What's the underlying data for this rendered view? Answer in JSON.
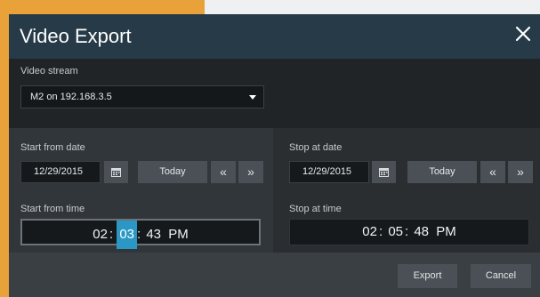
{
  "dialog": {
    "title": "Video Export",
    "close_icon": "close-icon"
  },
  "stream": {
    "label": "Video stream",
    "selected": "M2 on 192.168.3.5"
  },
  "start": {
    "date_label": "Start from date",
    "date_value": "12/29/2015",
    "today_label": "Today",
    "prev_icon": "double-chevron-left-icon",
    "next_icon": "double-chevron-right-icon",
    "time_label": "Start from time",
    "time": {
      "hour": "02",
      "minute": "03",
      "second": "43",
      "ampm": "PM"
    }
  },
  "stop": {
    "date_label": "Stop at date",
    "date_value": "12/29/2015",
    "today_label": "Today",
    "prev_icon": "double-chevron-left-icon",
    "next_icon": "double-chevron-right-icon",
    "time_label": "Stop at time",
    "time": {
      "hour": "02",
      "minute": "05",
      "second": "48",
      "ampm": "PM"
    }
  },
  "footer": {
    "export_label": "Export",
    "cancel_label": "Cancel"
  },
  "colors": {
    "title_bar": "#263a47",
    "selected_segment": "#2a97c4",
    "background_accent": "#e9a23a"
  }
}
